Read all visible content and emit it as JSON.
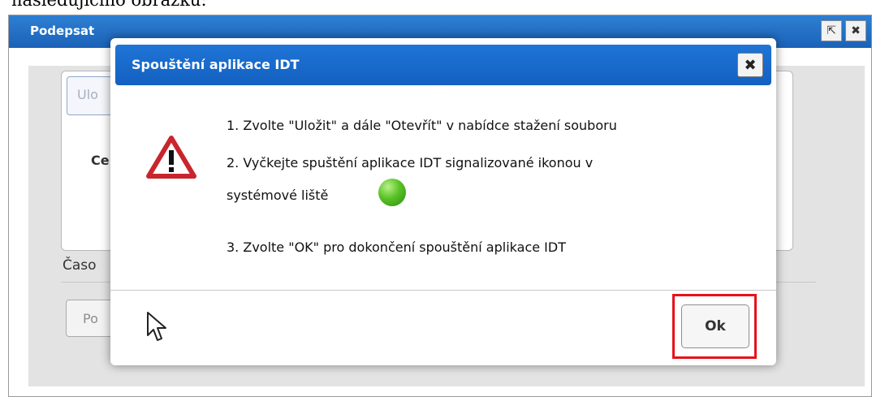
{
  "page_caption": "následujícího obrázku:",
  "background_window": {
    "title": "Podepsat",
    "tab_label": "Ulo",
    "field_label": "Ce",
    "caso_label": "Časo",
    "button_label": "Po",
    "title_buttons": [
      "popout-icon",
      "close-icon"
    ]
  },
  "dialog": {
    "title": "Spouštění aplikace IDT",
    "close_icon": "close-icon",
    "warning_icon": "warning-icon",
    "steps": [
      "1. Zvolte \"Uložit\" a dále \"Otevřít\" v nabídce stažení souboru",
      "2. Vyčkejte spuštění aplikace IDT signalizované ikonou v",
      "systémové liště",
      "3. Zvolte \"OK\" pro dokončení spouštění aplikace IDT"
    ],
    "tray_icon": "green-circle-icon",
    "ok_label": "Ok"
  },
  "colors": {
    "header_blue": "#1f75d6",
    "highlight_red": "#e8111c"
  }
}
